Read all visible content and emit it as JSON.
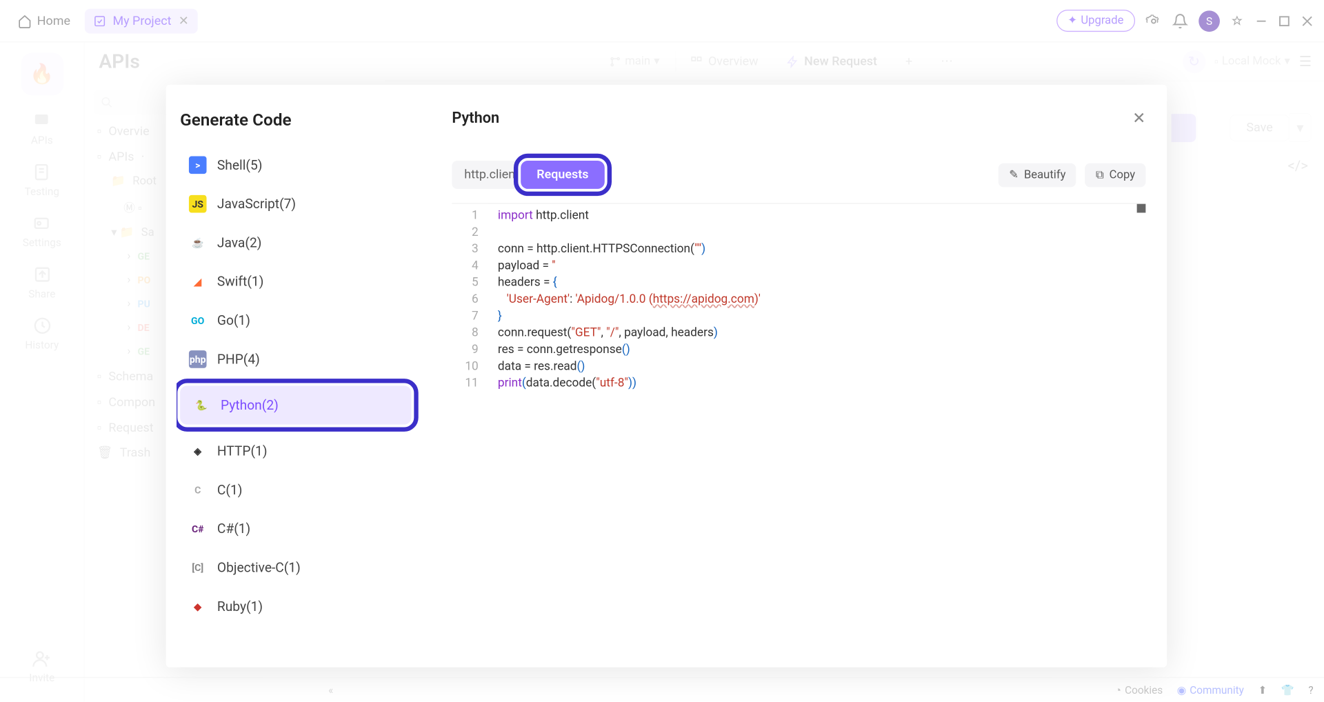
{
  "titlebar": {
    "home": "Home",
    "project": "My Project",
    "upgrade": "Upgrade",
    "avatar": "S"
  },
  "leftnav": {
    "items": [
      {
        "label": "APIs"
      },
      {
        "label": "Testing"
      },
      {
        "label": "Settings"
      },
      {
        "label": "Share"
      },
      {
        "label": "History"
      },
      {
        "label": "Invite"
      }
    ]
  },
  "main": {
    "title": "APIs",
    "branch": "main",
    "tabs": {
      "overview": "Overview",
      "newreq": "New Request"
    },
    "localmock": "Local Mock",
    "save": "Save"
  },
  "tree": {
    "overview": "Overvie",
    "apis": "APIs",
    "root": "Root",
    "sample": "Sa",
    "get": "GE",
    "post": "PO",
    "put": "PU",
    "del": "DE",
    "get2": "GE",
    "schemas": "Schema",
    "components": "Compon",
    "requests": "Request",
    "trash": "Trash"
  },
  "bottombar": {
    "cookies": "Cookies",
    "community": "Community"
  },
  "modal": {
    "title": "Generate Code",
    "panel_title": "Python",
    "subtab1": "http.clien",
    "subtab2": "Requests",
    "beautify": "Beautify",
    "copy": "Copy",
    "languages": [
      {
        "label": "Shell(5)",
        "bg": "#4a7eff",
        "txt": ">"
      },
      {
        "label": "JavaScript(7)",
        "bg": "#f7df1e",
        "txt": "JS",
        "fg": "#333"
      },
      {
        "label": "Java(2)",
        "bg": "transparent",
        "txt": "☕",
        "fg": "#e8a87c"
      },
      {
        "label": "Swift(1)",
        "bg": "transparent",
        "txt": "◢",
        "fg": "#ff6b35"
      },
      {
        "label": "Go(1)",
        "bg": "transparent",
        "txt": "GO",
        "fg": "#00add8"
      },
      {
        "label": "PHP(4)",
        "bg": "#8892bf",
        "txt": "php"
      },
      {
        "label": "Python(2)",
        "bg": "transparent",
        "txt": "🐍",
        "active": true
      },
      {
        "label": "HTTP(1)",
        "bg": "transparent",
        "txt": "◈",
        "fg": "#333"
      },
      {
        "label": "C(1)",
        "bg": "transparent",
        "txt": "C",
        "fg": "#aaa"
      },
      {
        "label": "C#(1)",
        "bg": "transparent",
        "txt": "C#",
        "fg": "#68217a"
      },
      {
        "label": "Objective-C(1)",
        "bg": "transparent",
        "txt": "[C]",
        "fg": "#888"
      },
      {
        "label": "Ruby(1)",
        "bg": "transparent",
        "txt": "◆",
        "fg": "#cc342d"
      }
    ],
    "code": {
      "l1a": "import",
      "l1b": " http.client",
      "l3a": "conn = http.client.HTTPSConnection(",
      "l3b": "\"\"",
      "l3c": ")",
      "l4a": "payload = ",
      "l4b": "''",
      "l5a": "headers = ",
      "l5b": "{",
      "l6a": "   ",
      "l6b": "'User-Agent'",
      "l6c": ": ",
      "l6d": "'Apidog/1.0.0 (",
      "l6e": "https://apidog.com",
      "l6f": ")'",
      "l7a": "}",
      "l8a": "conn.request(",
      "l8b": "\"GET\"",
      "l8c": ", ",
      "l8d": "\"/\"",
      "l8e": ", payload, headers",
      "l8f": ")",
      "l9a": "res = conn.getresponse",
      "l9b": "()",
      "l10a": "data = res.read",
      "l10b": "()",
      "l11a": "print",
      "l11b": "(",
      "l11c": "data.decode(",
      "l11d": "\"utf-8\"",
      "l11e": ")",
      "l11f": ")"
    }
  }
}
